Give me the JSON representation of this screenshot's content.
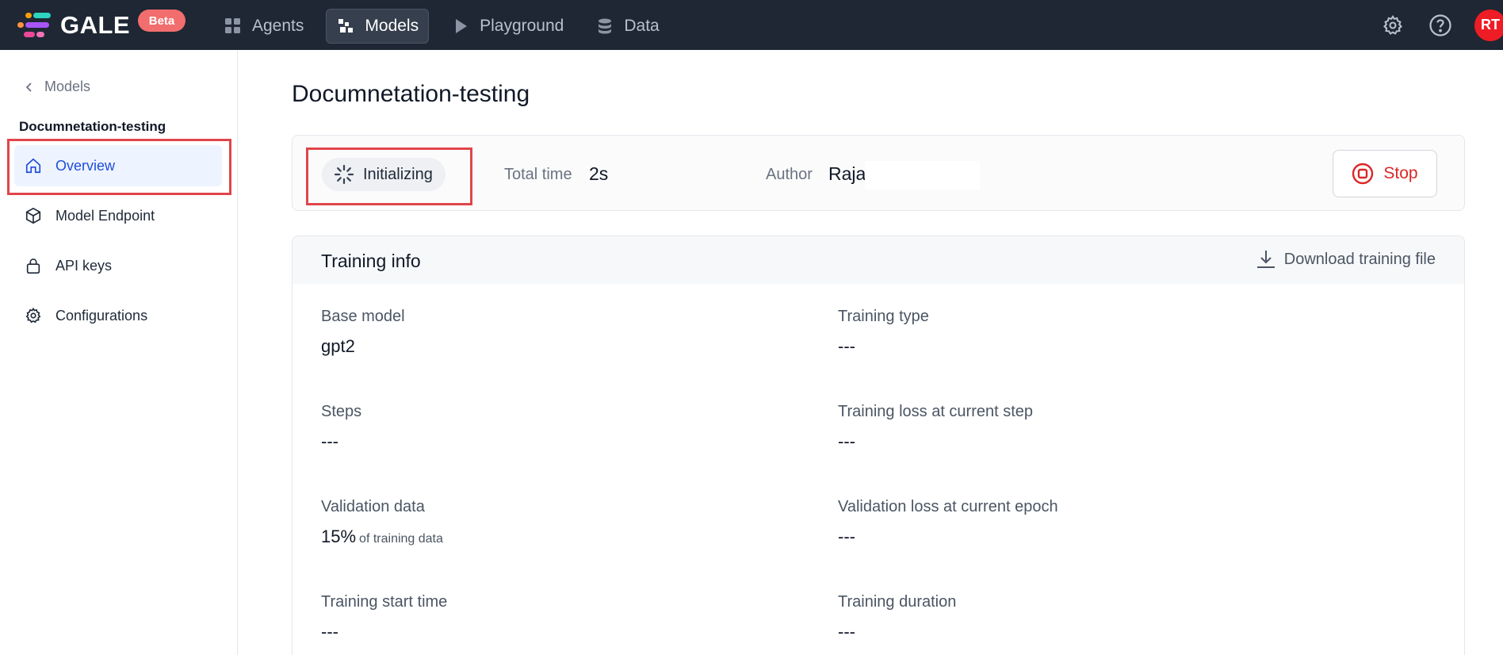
{
  "app": {
    "logo_text": "GALE",
    "beta_label": "Beta",
    "nav": [
      {
        "label": "Agents",
        "icon": "grid-icon"
      },
      {
        "label": "Models",
        "icon": "models-icon",
        "active": true
      },
      {
        "label": "Playground",
        "icon": "play-icon"
      },
      {
        "label": "Data",
        "icon": "database-icon"
      }
    ],
    "avatar_initials": "RT",
    "colors": {
      "accent": "#1d4ed8",
      "danger": "#dc2626",
      "topbar": "#1e2733",
      "avatar": "#ee1c25"
    }
  },
  "sidebar": {
    "back_label": "Models",
    "project_title": "Documnetation-testing",
    "items": [
      {
        "label": "Overview",
        "icon": "home-icon",
        "active": true
      },
      {
        "label": "Model Endpoint",
        "icon": "cube-icon"
      },
      {
        "label": "API keys",
        "icon": "lock-icon"
      },
      {
        "label": "Configurations",
        "icon": "gear-icon"
      }
    ]
  },
  "main": {
    "page_title": "Documnetation-testing",
    "status": {
      "state": "Initializing",
      "total_time_label": "Total time",
      "total_time_value": "2s",
      "author_label": "Author",
      "author_value": "Raja",
      "stop_label": "Stop"
    },
    "training_info": {
      "title": "Training info",
      "download_label": "Download training file",
      "fields": {
        "base_model": {
          "label": "Base model",
          "value": "gpt2"
        },
        "training_type": {
          "label": "Training type",
          "value": "---"
        },
        "steps": {
          "label": "Steps",
          "value": "---"
        },
        "training_loss": {
          "label": "Training loss at current step",
          "value": "---"
        },
        "validation_data": {
          "label": "Validation data",
          "value": "15%",
          "suffix": "of training data"
        },
        "validation_loss": {
          "label": "Validation loss at current epoch",
          "value": "---"
        },
        "training_start": {
          "label": "Training start time",
          "value": "---"
        },
        "training_duration": {
          "label": "Training duration",
          "value": "---"
        }
      }
    }
  }
}
